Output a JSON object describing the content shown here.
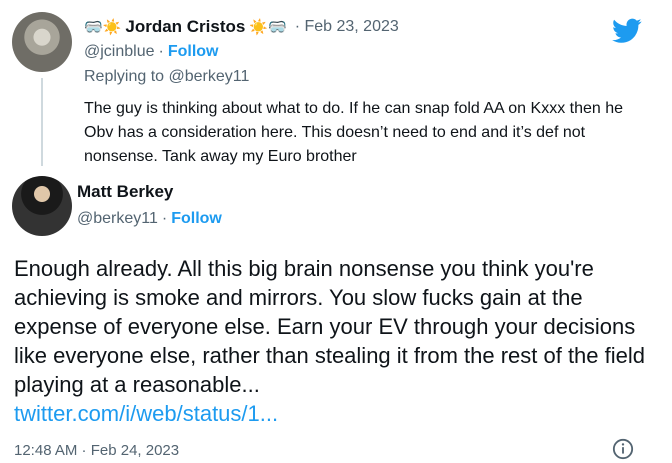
{
  "reply": {
    "name": "Jordan Cristos",
    "emoji_left": "🥽☀️",
    "emoji_right": "☀️🥽",
    "date": "· Feb 23, 2023",
    "handle": "@jcinblue",
    "separator": "·",
    "follow_label": "Follow",
    "replying_to": "Replying to @berkey11",
    "text": "The guy is thinking about what to do. If he can snap fold AA on Kxxx then he Obv has a consideration here. This doesn’t need to end and it’s def not nonsense. Tank away my Euro brother"
  },
  "main": {
    "name": "Matt Berkey",
    "handle": "@berkey11",
    "separator": "·",
    "follow_label": "Follow",
    "text": "Enough already. All this big brain nonsense you think you're achieving is smoke and mirrors. You slow fucks gain at the expense of everyone else. Earn your EV through your decisions like everyone else, rather than stealing it from the rest of the field playing at a reasonable...",
    "link": "twitter.com/i/web/status/1...",
    "timestamp": "12:48 AM · Feb 24, 2023"
  },
  "icons": {
    "brand": "twitter-bird-icon",
    "info": "info-icon"
  },
  "colors": {
    "accent": "#1d9bf0",
    "secondary_text": "#536471",
    "primary_text": "#0f1419"
  }
}
